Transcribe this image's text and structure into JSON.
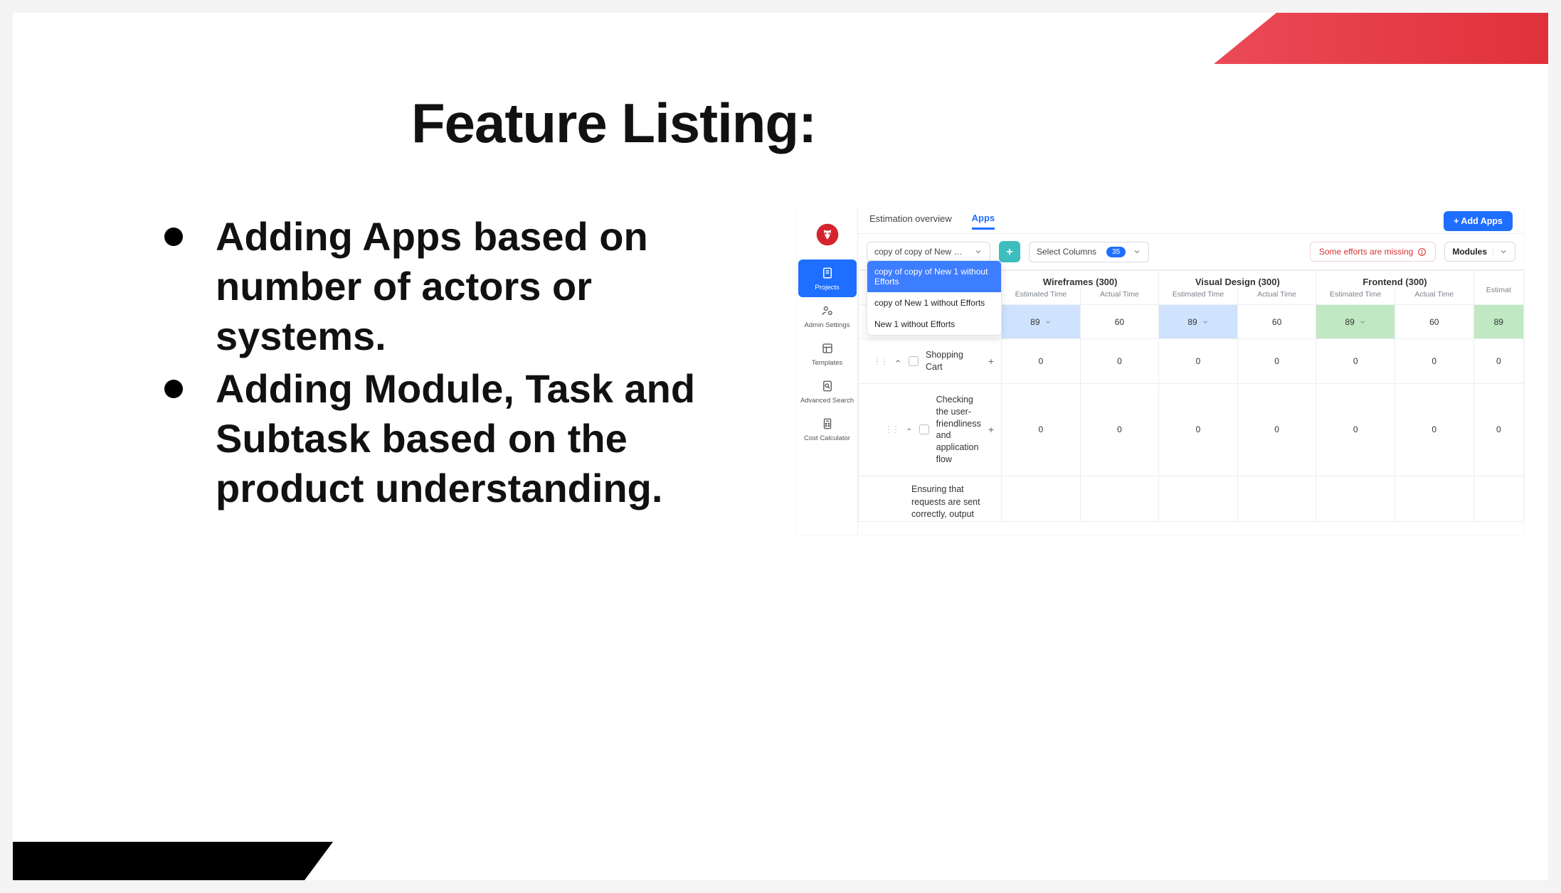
{
  "slide": {
    "title": "Feature Listing:",
    "bullets": [
      "Adding Apps based on number of actors or systems.",
      "Adding Module, Task and Subtask based on the product understanding."
    ]
  },
  "app": {
    "sidebar": {
      "items": [
        {
          "icon": "doc",
          "label": "Projects",
          "active": true
        },
        {
          "icon": "user-cog",
          "label": "Admin Settings",
          "active": false
        },
        {
          "icon": "layout",
          "label": "Templates",
          "active": false
        },
        {
          "icon": "search",
          "label": "Advanced Search",
          "active": false
        },
        {
          "icon": "calc",
          "label": "Cost Calculator",
          "active": false
        }
      ]
    },
    "tabs": {
      "estimation": "Estimation overview",
      "apps": "Apps",
      "add_apps": "+ Add Apps"
    },
    "toolbar": {
      "app_selector_value": "copy of copy of New 1 witho…",
      "select_columns_label": "Select Columns",
      "select_columns_count": "35",
      "warning": "Some efforts are missing",
      "modules_label": "Modules"
    },
    "dropdown": {
      "options": [
        "copy of copy of New 1 without Efforts",
        "copy of New 1 without Efforts",
        "New 1 without Efforts"
      ],
      "selected_index": 0
    },
    "columns": [
      {
        "group": "Wireframes (300)",
        "sub": [
          "Estimated Time",
          "Actual Time"
        ]
      },
      {
        "group": "Visual Design (300)",
        "sub": [
          "Estimated Time",
          "Actual Time"
        ]
      },
      {
        "group": "Frontend (300)",
        "sub": [
          "Estimated Time",
          "Actual Time"
        ]
      }
    ],
    "rows": [
      {
        "label": "",
        "values": [
          {
            "est": "89",
            "act": "60",
            "highlight": "blue"
          },
          {
            "est": "89",
            "act": "60",
            "highlight": "blue"
          },
          {
            "est": "89",
            "act": "60",
            "highlight": "green"
          }
        ],
        "trail_est": "89"
      },
      {
        "label": "Shopping Cart",
        "values": [
          {
            "est": "0",
            "act": "0"
          },
          {
            "est": "0",
            "act": "0"
          },
          {
            "est": "0",
            "act": "0"
          }
        ],
        "trail_est": "0"
      },
      {
        "label": "Checking the user-friendliness and application flow",
        "values": [
          {
            "est": "0",
            "act": "0"
          },
          {
            "est": "0",
            "act": "0"
          },
          {
            "est": "0",
            "act": "0"
          }
        ],
        "trail_est": "0"
      }
    ],
    "partial_row": "Ensuring that requests are sent correctly, output"
  }
}
